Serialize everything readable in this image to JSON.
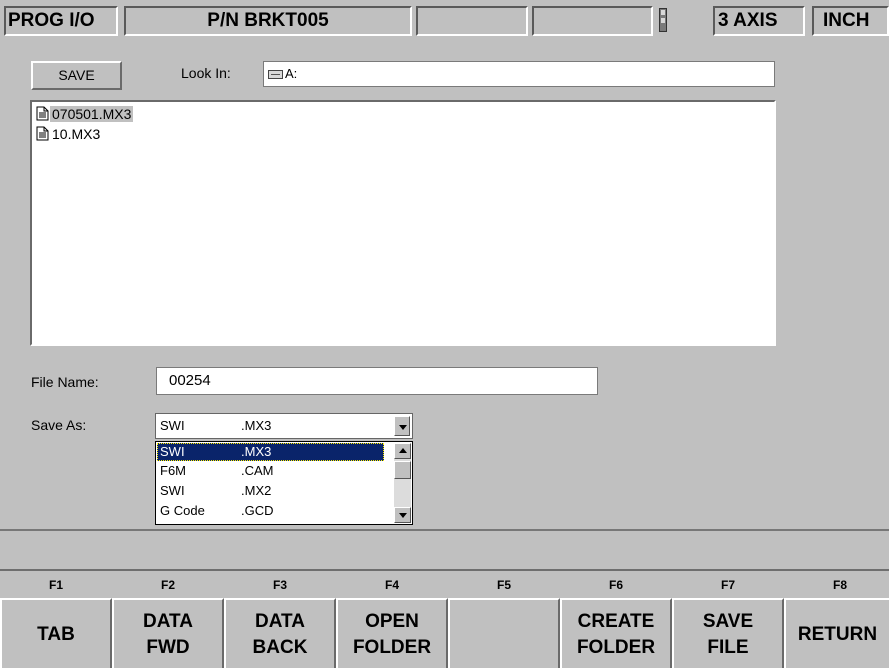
{
  "topbar": {
    "mode": "PROG I/O",
    "part_number": "P/N BRKT005",
    "axis": "3 AXIS",
    "units": "INCH"
  },
  "dialog": {
    "save_label": "SAVE",
    "look_in_label": "Look In:",
    "look_in_value": "A:",
    "files": [
      {
        "name": "070501.MX3",
        "selected": true
      },
      {
        "name": "10.MX3",
        "selected": false
      }
    ],
    "file_name_label": "File Name:",
    "file_name_value": "00254",
    "save_as_label": "Save As:",
    "save_as_selected": {
      "type": "SWI",
      "ext": ".MX3"
    },
    "save_as_options": [
      {
        "type": "SWI",
        "ext": ".MX3",
        "selected": true
      },
      {
        "type": "F6M",
        "ext": ".CAM",
        "selected": false
      },
      {
        "type": "SWI",
        "ext": ".MX2",
        "selected": false
      },
      {
        "type": "G Code",
        "ext": ".GCD",
        "selected": false
      }
    ]
  },
  "status": {
    "text": ""
  },
  "function_keys": [
    {
      "key": "F1",
      "label": "TAB"
    },
    {
      "key": "F2",
      "label": "DATA\nFWD"
    },
    {
      "key": "F3",
      "label": "DATA\nBACK"
    },
    {
      "key": "F4",
      "label": "OPEN\nFOLDER"
    },
    {
      "key": "F5",
      "label": ""
    },
    {
      "key": "F6",
      "label": "CREATE\nFOLDER"
    },
    {
      "key": "F7",
      "label": "SAVE\nFILE"
    },
    {
      "key": "F8",
      "label": "RETURN"
    }
  ],
  "colors": {
    "background": "#c0c0c0",
    "selection": "#0a246a",
    "field": "#ffffff"
  }
}
